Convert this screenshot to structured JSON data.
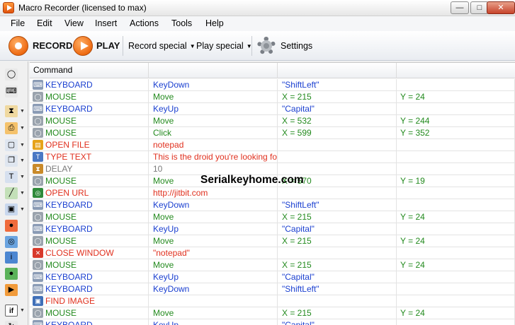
{
  "window": {
    "title": "Macro Recorder (licensed to max)",
    "min_label": "—",
    "max_label": "□",
    "close_label": "✕"
  },
  "menu": [
    "File",
    "Edit",
    "View",
    "Insert",
    "Actions",
    "Tools",
    "Help"
  ],
  "toolbar": {
    "record_label": "RECORD",
    "play_label": "PLAY",
    "record_special_label": "Record special",
    "play_special_label": "Play special",
    "settings_label": "Settings"
  },
  "table": {
    "headers": [
      "Command",
      "",
      "",
      ""
    ],
    "rows": [
      {
        "icon": "keyboard-icon",
        "kind": "keyboard",
        "cells": [
          "KEYBOARD",
          "KeyDown",
          "\"ShiftLeft\"",
          ""
        ]
      },
      {
        "icon": "mouse-icon",
        "kind": "mouse",
        "cells": [
          "MOUSE",
          "Move",
          "X = 215",
          "Y = 24"
        ]
      },
      {
        "icon": "keyboard-icon",
        "kind": "keyboard",
        "cells": [
          "KEYBOARD",
          "KeyUp",
          "\"Capital\"",
          ""
        ]
      },
      {
        "icon": "mouse-icon",
        "kind": "mouse",
        "cells": [
          "MOUSE",
          "Move",
          "X = 532",
          "Y = 244"
        ]
      },
      {
        "icon": "mouse-icon",
        "kind": "mouse",
        "cells": [
          "MOUSE",
          "Click",
          "X = 599",
          "Y = 352"
        ]
      },
      {
        "icon": "folder-icon",
        "kind": "special",
        "cells": [
          "OPEN FILE",
          "notepad",
          "",
          ""
        ]
      },
      {
        "icon": "text-icon",
        "kind": "special",
        "cells": [
          "TYPE TEXT",
          "This is the droid you're looking for!",
          "",
          ""
        ]
      },
      {
        "icon": "hourglass-icon",
        "kind": "delay",
        "cells": [
          "DELAY",
          "10",
          "",
          ""
        ]
      },
      {
        "icon": "mouse-icon",
        "kind": "mouse",
        "cells": [
          "MOUSE",
          "Move",
          "X = 570",
          "Y = 19"
        ]
      },
      {
        "icon": "globe-icon",
        "kind": "special",
        "cells": [
          "OPEN URL",
          "http://jitbit.com",
          "",
          ""
        ]
      },
      {
        "icon": "keyboard-icon",
        "kind": "keyboard",
        "cells": [
          "KEYBOARD",
          "KeyDown",
          "\"ShiftLeft\"",
          ""
        ]
      },
      {
        "icon": "mouse-icon",
        "kind": "mouse",
        "cells": [
          "MOUSE",
          "Move",
          "X = 215",
          "Y = 24"
        ]
      },
      {
        "icon": "keyboard-icon",
        "kind": "keyboard",
        "cells": [
          "KEYBOARD",
          "KeyUp",
          "\"Capital\"",
          ""
        ]
      },
      {
        "icon": "mouse-icon",
        "kind": "mouse",
        "cells": [
          "MOUSE",
          "Move",
          "X = 215",
          "Y = 24"
        ]
      },
      {
        "icon": "close-window-icon",
        "kind": "special",
        "cells": [
          "CLOSE WINDOW",
          "\"notepad\"",
          "",
          ""
        ]
      },
      {
        "icon": "mouse-icon",
        "kind": "mouse",
        "cells": [
          "MOUSE",
          "Move",
          "X = 215",
          "Y = 24"
        ]
      },
      {
        "icon": "keyboard-icon",
        "kind": "keyboard",
        "cells": [
          "KEYBOARD",
          "KeyUp",
          "\"Capital\"",
          ""
        ]
      },
      {
        "icon": "keyboard-icon",
        "kind": "keyboard",
        "cells": [
          "KEYBOARD",
          "KeyDown",
          "\"ShiftLeft\"",
          ""
        ]
      },
      {
        "icon": "image-icon",
        "kind": "special",
        "cells": [
          "FIND IMAGE",
          "",
          "",
          ""
        ]
      },
      {
        "icon": "mouse-icon",
        "kind": "mouse",
        "cells": [
          "MOUSE",
          "Move",
          "X = 215",
          "Y = 24"
        ]
      },
      {
        "icon": "keyboard-icon",
        "kind": "keyboard",
        "cells": [
          "KEYBOARD",
          "KeyUp",
          "\"Capital\"",
          ""
        ]
      }
    ]
  },
  "colors": {
    "keyboard": "#1a3fd0",
    "mouse": "#238a1e",
    "special": "#e0301e",
    "delay": "#7a7a7a"
  },
  "left_toolbar": [
    {
      "icon": "mouse-icon",
      "glyph": "◯",
      "caret": false
    },
    {
      "icon": "keyboard-icon",
      "glyph": "⌨",
      "caret": false
    },
    {
      "icon": "hourglass-icon",
      "glyph": "⧗",
      "caret": true
    },
    {
      "icon": "printer-icon",
      "glyph": "⎙",
      "caret": true
    },
    {
      "icon": "window-icon",
      "glyph": "▢",
      "caret": true
    },
    {
      "icon": "copy-icon",
      "glyph": "❐",
      "caret": true
    },
    {
      "icon": "text-icon",
      "glyph": "T",
      "caret": true
    },
    {
      "icon": "eyedropper-icon",
      "glyph": "╱",
      "caret": true
    },
    {
      "icon": "image-icon",
      "glyph": "▣",
      "caret": true
    },
    {
      "icon": "stop-icon",
      "glyph": "●",
      "caret": false
    },
    {
      "icon": "globe-icon",
      "glyph": "◎",
      "caret": false
    },
    {
      "icon": "info-icon",
      "glyph": "i",
      "caret": false
    },
    {
      "icon": "green-globe-icon",
      "glyph": "●",
      "caret": false
    },
    {
      "icon": "play-icon",
      "glyph": "▶",
      "caret": false
    },
    {
      "icon": "if-icon",
      "glyph": "if",
      "caret": true
    },
    {
      "icon": "loop-icon",
      "glyph": "↻",
      "caret": false
    }
  ],
  "watermark": "Serialkeyhome.com"
}
